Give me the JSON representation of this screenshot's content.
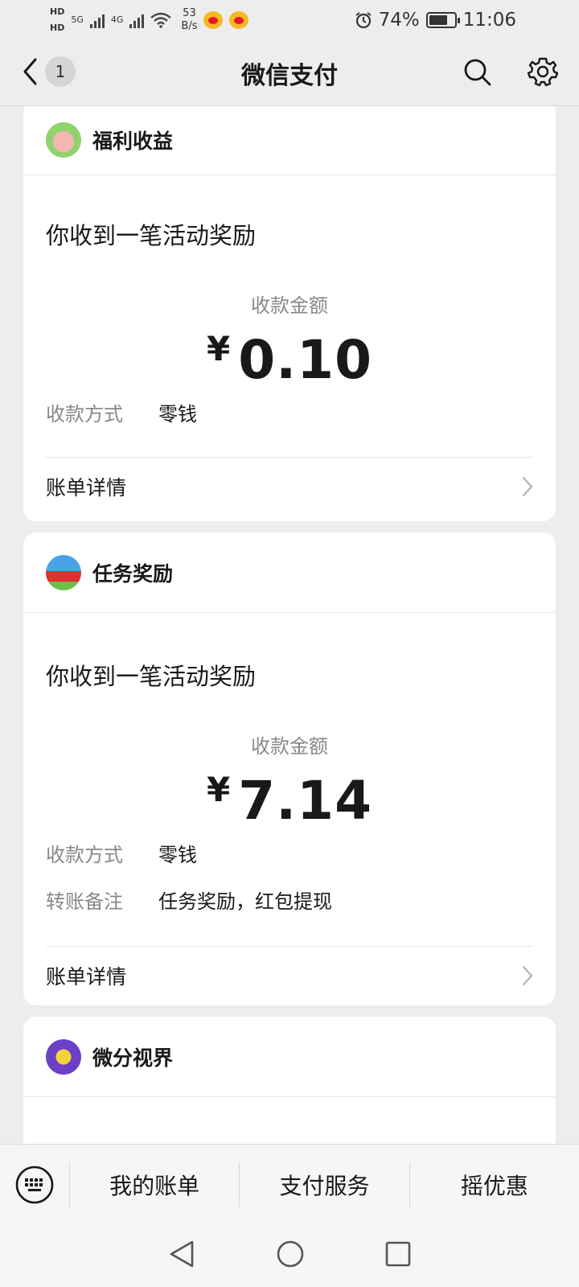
{
  "status_bar": {
    "hd1": "HD",
    "hd2": "HD",
    "net1": "5G",
    "net2": "4G",
    "speed_value": "53",
    "speed_unit": "B/s",
    "battery": "74%",
    "time": "11:06"
  },
  "nav": {
    "badge": "1",
    "title": "微信支付"
  },
  "cards": [
    {
      "name": "福利收益",
      "message": "你收到一笔活动奖励",
      "amount_label": "收款金额",
      "currency": "¥",
      "amount": "0.10",
      "method_label": "收款方式",
      "method_value": "零钱",
      "detail": "账单详情"
    },
    {
      "name": "任务奖励",
      "message": "你收到一笔活动奖励",
      "amount_label": "收款金额",
      "currency": "¥",
      "amount": "7.14",
      "method_label": "收款方式",
      "method_value": "零钱",
      "note_label": "转账备注",
      "note_value": "任务奖励，红包提现",
      "detail": "账单详情"
    },
    {
      "name": "微分视界"
    }
  ],
  "bottom_menu": {
    "items": [
      "我的账单",
      "支付服务",
      "摇优惠"
    ]
  },
  "icons": {
    "back": "chevron-left-icon",
    "search": "search-icon",
    "settings": "gear-icon",
    "keyboard": "keyboard-icon",
    "detail_arrow": "chevron-right-icon"
  }
}
